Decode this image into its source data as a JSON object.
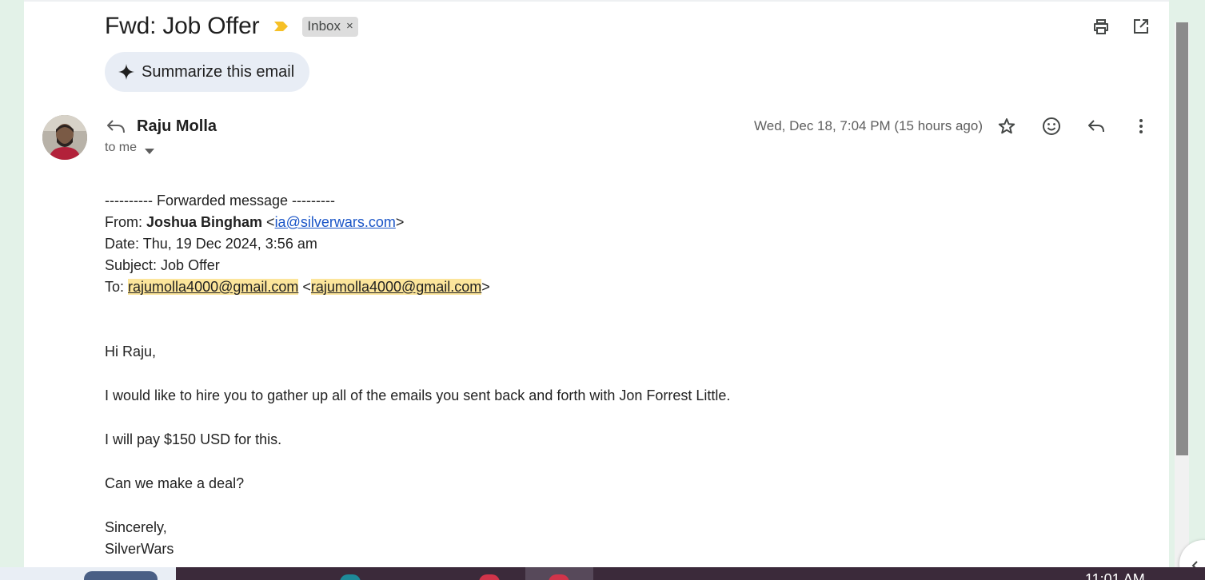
{
  "subject": "Fwd: Job Offer",
  "label_chip": {
    "text": "Inbox",
    "remove": "×"
  },
  "toolbar": {
    "print_icon": "print-icon",
    "open_new_window_icon": "open-in-new-window-icon"
  },
  "summarize": {
    "label": "Summarize this email",
    "icon": "sparkle-icon"
  },
  "message": {
    "sender_name": "Raju Molla",
    "recipient": "to me",
    "timestamp": "Wed, Dec 18, 7:04 PM (15 hours ago)",
    "actions": [
      "star-icon",
      "emoji-reaction-icon",
      "reply-icon",
      "more-options-icon"
    ]
  },
  "forwarded": {
    "header": "---------- Forwarded message ---------",
    "from_label": "From:",
    "from_name": "Joshua Bingham",
    "from_email": "ia@silverwars.com",
    "date_line": "Date: Thu, 19 Dec 2024, 3:56 am",
    "subject_line": "Subject: Job Offer",
    "to_label": "To:",
    "to_name": "rajumolla4000@gmail.com",
    "to_email": "rajumolla4000@gmail.com"
  },
  "body": {
    "greeting": "Hi Raju,",
    "paragraph1": "I would like to hire you to gather up all of the emails you sent back and forth with Jon Forrest Little.",
    "paragraph2": "I will pay $150 USD for this.",
    "paragraph3": "Can we make a deal?",
    "closing": "Sincerely,",
    "signature": "SilverWars"
  },
  "taskbar": {
    "clock": "11:01 AM"
  },
  "colors": {
    "highlight": "#fce59b",
    "link": "#1a55c7",
    "importance_marker": "#f6c026",
    "summarize_bg": "#e8edf5"
  }
}
